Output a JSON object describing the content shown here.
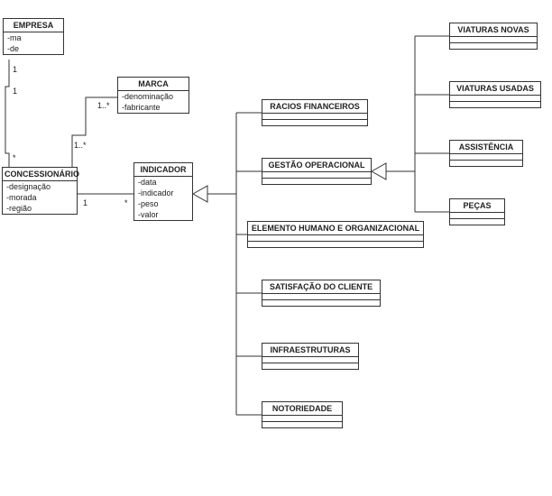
{
  "classes": {
    "empresa": {
      "name": "EMPRESA",
      "attrs": [
        "-ma",
        "-de"
      ]
    },
    "marca": {
      "name": "MARCA",
      "attrs": [
        "-denominação",
        "-fabricante"
      ]
    },
    "concessionario": {
      "name": "CONCESSIONÁRIO",
      "attrs": [
        "-designação",
        "-morada",
        "-região"
      ]
    },
    "indicador": {
      "name": "INDICADOR",
      "attrs": [
        "-data",
        "-indicador",
        "-peso",
        "-valor"
      ]
    },
    "raciosFinanceiros": {
      "name": "RACIOS FINANCEIROS"
    },
    "gestaoOperacional": {
      "name": "GESTÃO OPERACIONAL"
    },
    "elementoHumano": {
      "name": "ELEMENTO HUMANO E ORGANIZACIONAL"
    },
    "satisfacaoCliente": {
      "name": "SATISFAÇÃO DO CLIENTE"
    },
    "infraestruturas": {
      "name": "INFRAESTRUTURAS"
    },
    "notoriedade": {
      "name": "NOTORIEDADE"
    },
    "viaturasNovas": {
      "name": "VIATURAS NOVAS"
    },
    "viaturasUsadas": {
      "name": "VIATURAS USADAS"
    },
    "assistencia": {
      "name": "ASSISTÊNCIA"
    },
    "pecas": {
      "name": "PEÇAS"
    }
  },
  "multiplicities": {
    "empresa_conc_top": "1",
    "empresa_conc_bot": "*",
    "empresa_conc_bot2": "1",
    "conc_marca_top": "1..*",
    "conc_marca_bot": "1..*",
    "conc_ind_left": "1",
    "conc_ind_right": "*"
  }
}
